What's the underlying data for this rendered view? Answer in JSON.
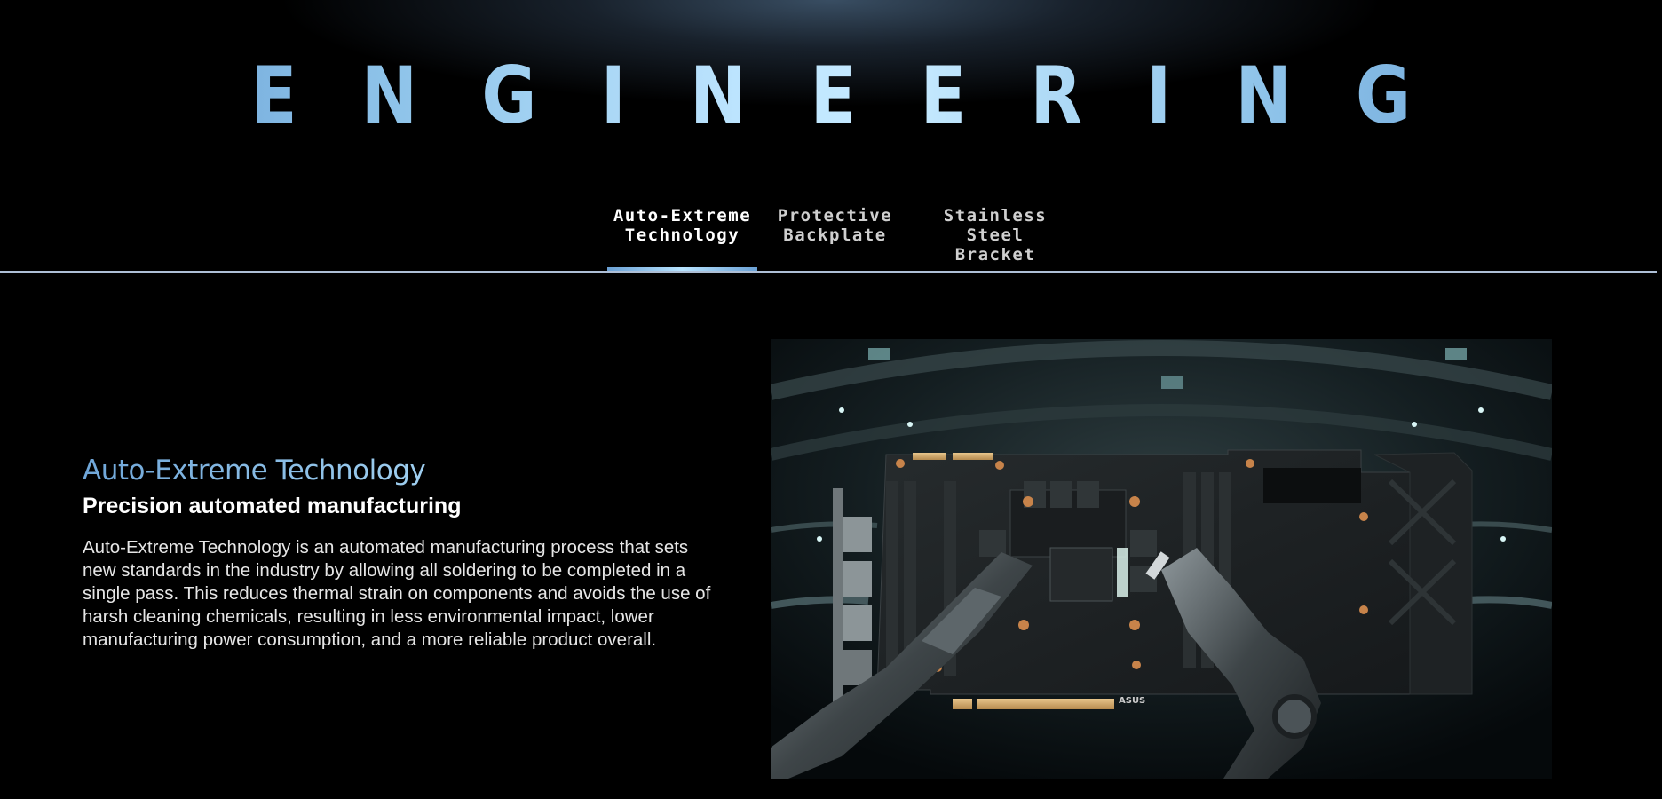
{
  "hero": {
    "title": "ENGINEERING"
  },
  "tabs": [
    {
      "line1": "Auto-Extreme",
      "line2": "Technology",
      "active": true
    },
    {
      "line1": "Protective",
      "line2": "Backplate",
      "active": false
    },
    {
      "line1": "Stainless Steel",
      "line2": "Bracket",
      "active": false
    }
  ],
  "feature": {
    "title": "Auto-Extreme Technology",
    "subtitle": "Precision automated manufacturing",
    "body": "Auto-Extreme Technology is an automated manufacturing process that sets new standards in the industry by allowing all soldering to be completed in a single pass. This reduces thermal strain on components and avoids the use of harsh cleaning chemicals, resulting in less environmental impact, lower manufacturing power consumption, and a more reliable product overall.",
    "image_alt": "Robotic arms assembling a graphics card circuit board",
    "board_logo": "ASUS"
  },
  "colors": {
    "background": "#000000",
    "accent_light": "#bfe6ff",
    "accent": "#6fa6d8",
    "divider": "#aebfd6"
  }
}
